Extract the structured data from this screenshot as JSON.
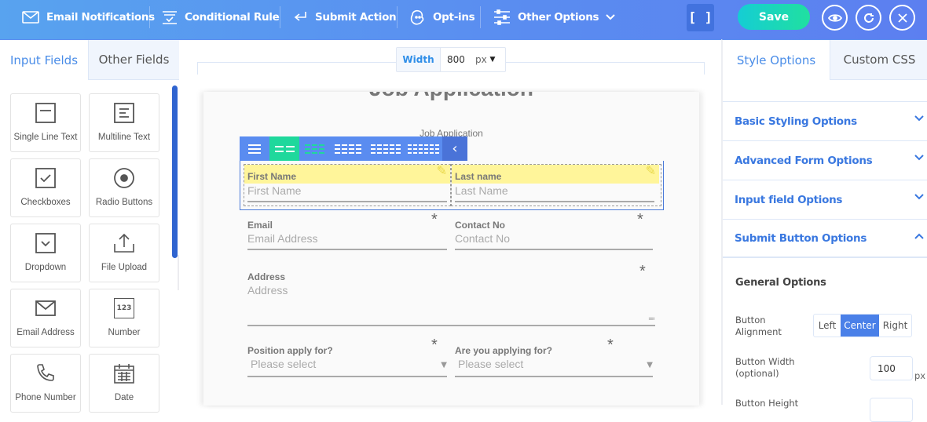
{
  "topbar": {
    "nav": [
      {
        "label": "Email Notifications",
        "icon": "envelope-icon"
      },
      {
        "label": "Conditional Rule",
        "icon": "conditional-check-icon"
      },
      {
        "label": "Submit Action",
        "icon": "return-arrow-icon"
      },
      {
        "label": "Opt-ins",
        "icon": "mailchimp-icon"
      },
      {
        "label": "Other Options",
        "icon": "sliders-icon"
      }
    ],
    "fullscreen_label": "[ ]",
    "save_label": "Save",
    "colors": {
      "bar": "#5a8df0",
      "save": "#1fd8a8",
      "fullscreen": "#4272de"
    }
  },
  "left_panel": {
    "tabs": [
      {
        "label": "Input Fields",
        "active": true
      },
      {
        "label": "Other Fields",
        "active": false
      }
    ],
    "fields": [
      {
        "label": "Single Line Text",
        "icon": "single-line-text-icon"
      },
      {
        "label": "Multiline Text",
        "icon": "multiline-text-icon"
      },
      {
        "label": "Checkboxes",
        "icon": "checkbox-icon"
      },
      {
        "label": "Radio Buttons",
        "icon": "radio-icon"
      },
      {
        "label": "Dropdown",
        "icon": "dropdown-icon"
      },
      {
        "label": "File Upload",
        "icon": "upload-icon"
      },
      {
        "label": "Email Address",
        "icon": "envelope-icon"
      },
      {
        "label": "Number",
        "icon": "number-icon",
        "glyph": "123"
      },
      {
        "label": "Phone Number",
        "icon": "phone-icon"
      },
      {
        "label": "Date",
        "icon": "calendar-icon"
      }
    ]
  },
  "canvas": {
    "width_label": "Width",
    "width_value": "800",
    "width_unit": "px",
    "form_title": "Job Application",
    "form_subtitle": "Job Application",
    "required_mark": "*",
    "fields": {
      "first_name": {
        "label": "First Name",
        "placeholder": "First Name"
      },
      "last_name": {
        "label": "Last name",
        "placeholder": "Last Name"
      },
      "email": {
        "label": "Email",
        "placeholder": "Email Address"
      },
      "contact": {
        "label": "Contact No",
        "placeholder": "Contact No"
      },
      "address": {
        "label": "Address",
        "placeholder": "Address"
      },
      "position": {
        "label": "Position apply for?",
        "placeholder": "Please select"
      },
      "applying": {
        "label": "Are you applying for?",
        "placeholder": "Please select"
      }
    },
    "column_layouts": [
      "1 column",
      "2 columns",
      "3 columns",
      "4 columns",
      "5 columns",
      "6 columns"
    ],
    "active_layout": "2 columns"
  },
  "right_panel": {
    "tabs": [
      {
        "label": "Style Options",
        "active": true
      },
      {
        "label": "Custom CSS",
        "active": false
      }
    ],
    "sections": [
      {
        "label": "Basic Styling Options",
        "expanded": false
      },
      {
        "label": "Advanced Form Options",
        "expanded": false
      },
      {
        "label": "Input field Options",
        "expanded": false
      },
      {
        "label": "Submit Button Options",
        "expanded": true
      }
    ],
    "general_options_title": "General Options",
    "button_alignment": {
      "label": "Button Alignment",
      "options": [
        "Left",
        "Center",
        "Right"
      ],
      "selected": "Center"
    },
    "button_width": {
      "label": "Button Width (optional)",
      "value": "100",
      "unit": "px"
    },
    "button_height": {
      "label": "Button Height"
    }
  }
}
